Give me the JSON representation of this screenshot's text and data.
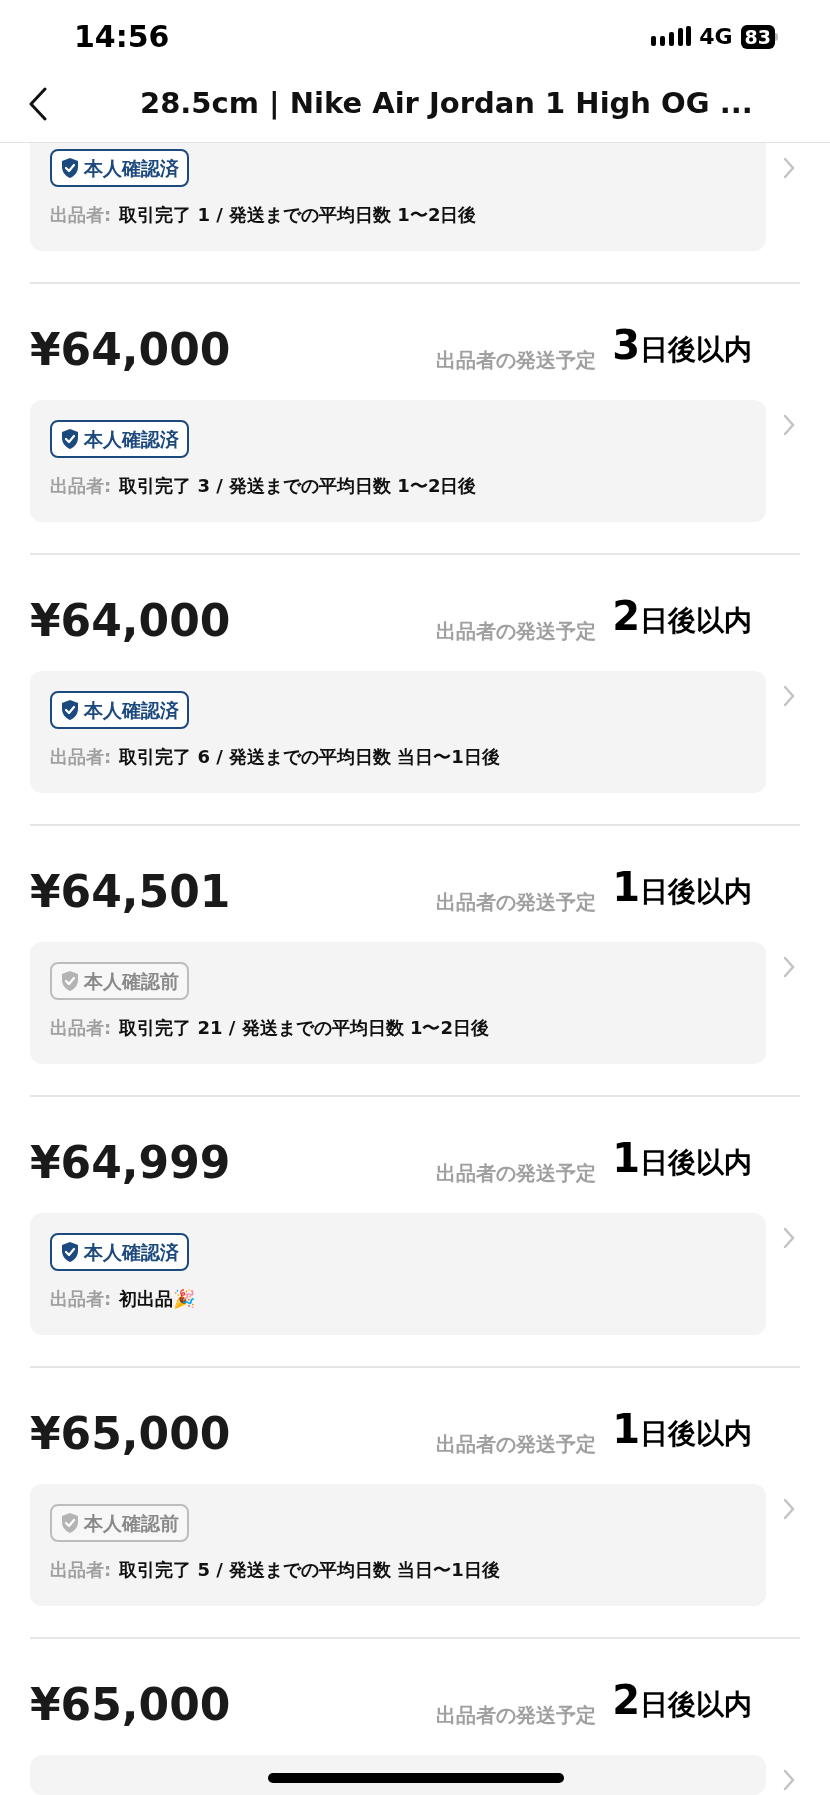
{
  "status_bar": {
    "time": "14:56",
    "network": "4G",
    "battery": "83"
  },
  "header": {
    "title": "28.5cm | Nike Air Jordan 1 High OG ..."
  },
  "listings": [
    {
      "badge": "本人確認済",
      "verified": true,
      "seller_label": "出品者:",
      "seller": "取引完了 1 / 発送までの平均日数 1〜2日後"
    },
    {
      "price": "¥64,000",
      "shipping_label": "出品者の発送予定",
      "days": "3",
      "days_suffix": "日後以内",
      "badge": "本人確認済",
      "verified": true,
      "seller_label": "出品者:",
      "seller": "取引完了 3 / 発送までの平均日数 1〜2日後"
    },
    {
      "price": "¥64,000",
      "shipping_label": "出品者の発送予定",
      "days": "2",
      "days_suffix": "日後以内",
      "badge": "本人確認済",
      "verified": true,
      "seller_label": "出品者:",
      "seller": "取引完了 6 / 発送までの平均日数 当日〜1日後"
    },
    {
      "price": "¥64,501",
      "shipping_label": "出品者の発送予定",
      "days": "1",
      "days_suffix": "日後以内",
      "badge": "本人確認前",
      "verified": false,
      "seller_label": "出品者:",
      "seller": "取引完了 21 / 発送までの平均日数 1〜2日後"
    },
    {
      "price": "¥64,999",
      "shipping_label": "出品者の発送予定",
      "days": "1",
      "days_suffix": "日後以内",
      "badge": "本人確認済",
      "verified": true,
      "seller_label": "出品者:",
      "seller": "初出品🎉"
    },
    {
      "price": "¥65,000",
      "shipping_label": "出品者の発送予定",
      "days": "1",
      "days_suffix": "日後以内",
      "badge": "本人確認前",
      "verified": false,
      "seller_label": "出品者:",
      "seller": "取引完了 5 / 発送までの平均日数 当日〜1日後"
    },
    {
      "price": "¥65,000",
      "shipping_label": "出品者の発送予定",
      "days": "2",
      "days_suffix": "日後以内"
    }
  ]
}
